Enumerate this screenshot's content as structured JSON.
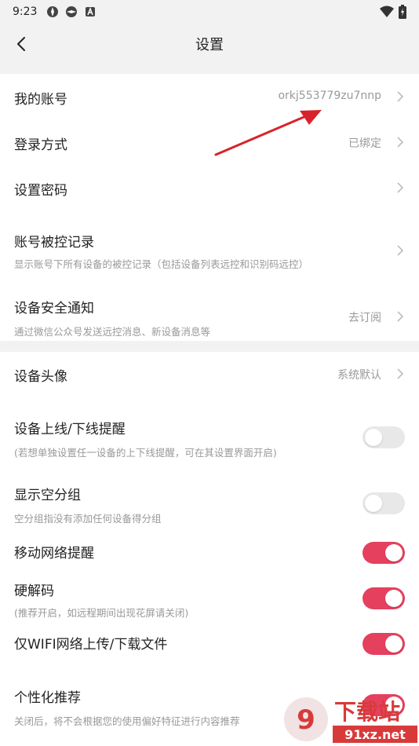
{
  "status_bar": {
    "time": "9:23"
  },
  "header": {
    "title": "设置"
  },
  "account": {
    "my_account": {
      "label": "我的账号",
      "value": "orkj553779zu7nnp"
    },
    "login_method": {
      "label": "登录方式",
      "value": "已绑定"
    },
    "set_password": {
      "label": "设置密码"
    },
    "control_log": {
      "label": "账号被控记录",
      "desc": "显示账号下所有设备的被控记录（包括设备列表远控和识别码远控）"
    },
    "security_notice": {
      "label": "设备安全通知",
      "desc": "通过微信公众号发送远控消息、新设备消息等",
      "value": "去订阅"
    }
  },
  "device": {
    "avatar": {
      "label": "设备头像",
      "value": "系统默认"
    },
    "online_alert": {
      "label": "设备上线/下线提醒",
      "desc": "(若想单独设置任一设备的上下线提醒，可在其设置界面开启)",
      "on": false
    },
    "show_empty_group": {
      "label": "显示空分组",
      "desc": "空分组指没有添加任何设备得分组",
      "on": false
    },
    "mobile_network": {
      "label": "移动网络提醒",
      "on": true
    },
    "hw_decode": {
      "label": "硬解码",
      "desc": "(推荐开启，如远程期间出现花屏请关闭)",
      "on": true
    },
    "wifi_only": {
      "label": "仅WIFI网络上传/下载文件",
      "on": true
    },
    "personalized": {
      "label": "个性化推荐",
      "desc": "关闭后，将不会根据您的使用偏好特征进行内容推荐",
      "on": true
    }
  },
  "watermark": {
    "text": "下载站",
    "domain": "91xz.net"
  },
  "colors": {
    "accent": "#e5405e",
    "annotation": "#d8232a"
  }
}
